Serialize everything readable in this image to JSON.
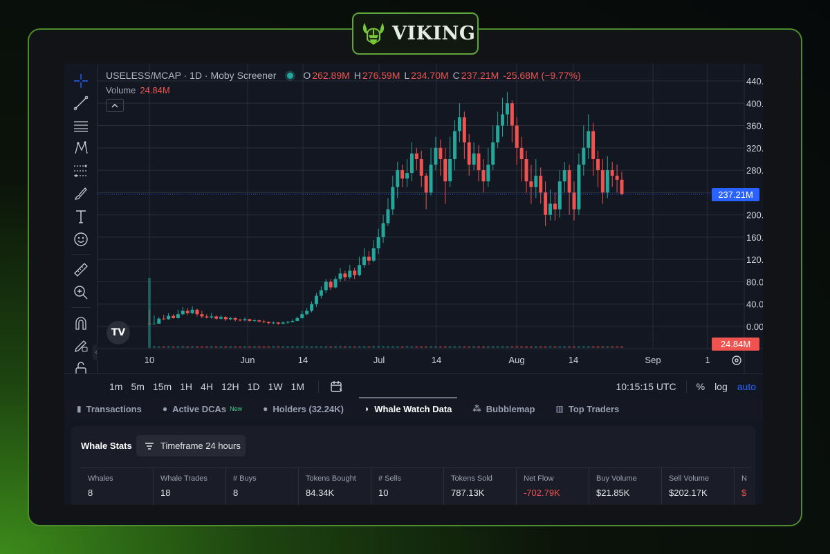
{
  "brand": {
    "name": "VIKING"
  },
  "chart": {
    "symbol": "USELESS/MCAP · 1D · Moby Screener",
    "ohlc": [
      {
        "k": "O",
        "v": "262.89M"
      },
      {
        "k": "H",
        "v": "276.59M"
      },
      {
        "k": "L",
        "v": "234.70M"
      },
      {
        "k": "C",
        "v": "237.21M"
      }
    ],
    "change": "-25.68M (−9.77%)",
    "volume_label": "Volume",
    "volume_value": "24.84M",
    "last_price_tag": "237.21M",
    "volume_tag": "24.84M",
    "tv_logo": "TV"
  },
  "colors": {
    "up": "#26a69a",
    "down": "#ef5350",
    "price_tag": "#2962ff",
    "accent_green": "#4d8d2c"
  },
  "chart_data": {
    "type": "candlestick",
    "y_axis_labels": [
      "440.00M",
      "400.00M",
      "360.00M",
      "320.00M",
      "280.00M",
      "200.00M",
      "160.00M",
      "120.00M",
      "80.00M",
      "40.00M",
      "0.00"
    ],
    "ylim": [
      0,
      440
    ],
    "y_unit": "M",
    "x_axis_labels": [
      "10",
      "Jun",
      "14",
      "Jul",
      "14",
      "Aug",
      "14",
      "Sep",
      "1"
    ],
    "candles": [
      [
        5,
        4,
        30,
        4
      ],
      [
        4,
        5,
        20,
        5
      ],
      [
        5,
        14,
        17,
        5
      ],
      [
        14,
        13,
        21,
        12
      ],
      [
        13,
        19,
        24,
        12
      ],
      [
        19,
        15,
        22,
        14
      ],
      [
        15,
        22,
        30,
        14
      ],
      [
        22,
        28,
        35,
        20
      ],
      [
        28,
        24,
        33,
        20
      ],
      [
        24,
        30,
        36,
        22
      ],
      [
        30,
        22,
        32,
        18
      ],
      [
        22,
        18,
        28,
        15
      ],
      [
        18,
        16,
        22,
        14
      ],
      [
        16,
        18,
        24,
        14
      ],
      [
        18,
        14,
        20,
        12
      ],
      [
        14,
        17,
        20,
        12
      ],
      [
        17,
        13,
        18,
        10
      ],
      [
        13,
        15,
        17,
        11
      ],
      [
        15,
        12,
        16,
        9
      ],
      [
        12,
        11,
        14,
        9
      ],
      [
        11,
        13,
        16,
        9
      ],
      [
        13,
        10,
        14,
        8
      ],
      [
        10,
        11,
        13,
        8
      ],
      [
        11,
        9,
        12,
        7
      ],
      [
        9,
        8,
        12,
        6
      ],
      [
        8,
        6,
        9,
        4
      ],
      [
        6,
        7,
        9,
        4
      ],
      [
        7,
        5,
        8,
        3
      ],
      [
        5,
        7,
        9,
        4
      ],
      [
        7,
        8,
        10,
        5
      ],
      [
        8,
        10,
        13,
        7
      ],
      [
        10,
        15,
        18,
        9
      ],
      [
        15,
        22,
        28,
        14
      ],
      [
        22,
        28,
        33,
        20
      ],
      [
        28,
        40,
        45,
        25
      ],
      [
        40,
        55,
        60,
        35
      ],
      [
        55,
        65,
        72,
        50
      ],
      [
        65,
        80,
        85,
        60
      ],
      [
        80,
        70,
        85,
        65
      ],
      [
        70,
        85,
        90,
        68
      ],
      [
        85,
        95,
        105,
        80
      ],
      [
        95,
        88,
        100,
        82
      ],
      [
        88,
        100,
        110,
        85
      ],
      [
        100,
        92,
        105,
        85
      ],
      [
        92,
        110,
        125,
        90
      ],
      [
        110,
        125,
        140,
        105
      ],
      [
        125,
        118,
        135,
        110
      ],
      [
        118,
        140,
        155,
        115
      ],
      [
        140,
        160,
        175,
        130
      ],
      [
        160,
        185,
        200,
        150
      ],
      [
        185,
        210,
        230,
        180
      ],
      [
        210,
        250,
        270,
        200
      ],
      [
        250,
        280,
        295,
        230
      ],
      [
        280,
        265,
        290,
        250
      ],
      [
        265,
        275,
        300,
        250
      ],
      [
        275,
        310,
        330,
        260
      ],
      [
        310,
        300,
        320,
        280
      ],
      [
        300,
        270,
        315,
        250
      ],
      [
        270,
        240,
        275,
        210
      ],
      [
        240,
        290,
        320,
        235
      ],
      [
        290,
        320,
        340,
        280
      ],
      [
        320,
        300,
        335,
        270
      ],
      [
        300,
        260,
        320,
        220
      ],
      [
        260,
        300,
        340,
        250
      ],
      [
        300,
        350,
        370,
        280
      ],
      [
        350,
        375,
        400,
        330
      ],
      [
        375,
        330,
        385,
        300
      ],
      [
        330,
        290,
        345,
        270
      ],
      [
        290,
        310,
        330,
        280
      ],
      [
        310,
        280,
        325,
        260
      ],
      [
        280,
        260,
        300,
        240
      ],
      [
        260,
        290,
        320,
        250
      ],
      [
        290,
        330,
        360,
        280
      ],
      [
        330,
        360,
        385,
        320
      ],
      [
        360,
        380,
        410,
        340
      ],
      [
        380,
        400,
        420,
        360
      ],
      [
        400,
        360,
        405,
        330
      ],
      [
        360,
        320,
        375,
        290
      ],
      [
        320,
        300,
        340,
        260
      ],
      [
        300,
        260,
        315,
        240
      ],
      [
        260,
        250,
        290,
        220
      ],
      [
        250,
        270,
        300,
        230
      ],
      [
        270,
        240,
        285,
        220
      ],
      [
        240,
        200,
        260,
        180
      ],
      [
        200,
        220,
        245,
        190
      ],
      [
        220,
        210,
        240,
        190
      ],
      [
        210,
        260,
        280,
        195
      ],
      [
        260,
        280,
        295,
        240
      ],
      [
        280,
        240,
        290,
        200
      ],
      [
        240,
        210,
        260,
        190
      ],
      [
        210,
        290,
        310,
        200
      ],
      [
        290,
        320,
        360,
        270
      ],
      [
        320,
        350,
        380,
        300
      ],
      [
        350,
        300,
        365,
        270
      ],
      [
        300,
        280,
        315,
        250
      ],
      [
        280,
        240,
        300,
        220
      ],
      [
        240,
        280,
        305,
        230
      ],
      [
        280,
        270,
        295,
        250
      ],
      [
        270,
        263,
        290,
        240
      ],
      [
        263,
        237,
        277,
        235
      ]
    ],
    "title": "USELESS/MCAP · 1D · Moby Screener",
    "grid": true
  },
  "intervals": [
    "1m",
    "5m",
    "15m",
    "1H",
    "4H",
    "12H",
    "1D",
    "1W",
    "1M"
  ],
  "interval_right": {
    "time": "10:15:15 UTC",
    "percent": "%",
    "log": "log",
    "auto": "auto"
  },
  "tabs": [
    {
      "label": "Transactions",
      "icon": "receipt-icon",
      "glyph": "▮"
    },
    {
      "label": "Active DCAs",
      "icon": "coins-icon",
      "glyph": "●",
      "badge": "New"
    },
    {
      "label": "Holders (32.24K)",
      "icon": "user-icon",
      "glyph": "●"
    },
    {
      "label": "Whale Watch Data",
      "icon": "whale-icon",
      "glyph": "◗"
    },
    {
      "label": "Bubblemap",
      "icon": "bubbles-icon",
      "glyph": "⁂"
    },
    {
      "label": "Top Traders",
      "icon": "chart-icon",
      "glyph": "▥"
    }
  ],
  "whale": {
    "title": "Whale Stats",
    "timeframe_label": "Timeframe 24 hours",
    "stats": [
      {
        "h": "Whales",
        "v": "8"
      },
      {
        "h": "Whale Trades",
        "v": "18"
      },
      {
        "h": "# Buys",
        "v": "8"
      },
      {
        "h": "Tokens Bought",
        "v": "84.34K"
      },
      {
        "h": "# Sells",
        "v": "10"
      },
      {
        "h": "Tokens Sold",
        "v": "787.13K"
      },
      {
        "h": "Net Flow",
        "v": "-702.79K",
        "neg": true
      },
      {
        "h": "Buy Volume",
        "v": "$21.85K"
      },
      {
        "h": "Sell Volume",
        "v": "$202.17K"
      },
      {
        "h": "N",
        "v": "$",
        "neg": true
      }
    ]
  }
}
